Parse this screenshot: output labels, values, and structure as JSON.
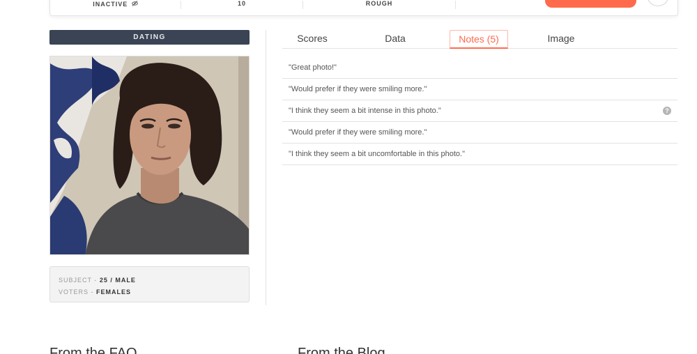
{
  "topbar": {
    "status_label": "INACTIVE",
    "status_icon": "eye-slash-icon",
    "count_value": "10",
    "mode_label": "ROUGH"
  },
  "left": {
    "category": "DATING",
    "subject_key": "SUBJECT",
    "subject_value": "25 / MALE",
    "voters_key": "VOTERS",
    "voters_value": "FEMALES",
    "separator": " - "
  },
  "tabs": [
    {
      "label": "Scores"
    },
    {
      "label": "Data"
    },
    {
      "label": "Notes (5)"
    },
    {
      "label": "Image"
    }
  ],
  "active_tab": "Notes (5)",
  "notes": [
    {
      "text": "\"Great photo!\""
    },
    {
      "text": "\"Would prefer if they were smiling more.\""
    },
    {
      "text": "\"I think they seem a bit intense in this photo.\""
    },
    {
      "text": "\"Would prefer if they were smiling more.\""
    },
    {
      "text": "\"I think they seem a bit uncomfortable in this photo.\""
    }
  ],
  "help_icon_glyph": "?",
  "footer": {
    "left_heading": "From the FAQ",
    "right_heading": "From the Blog"
  },
  "colors": {
    "accent": "#ff6a4d",
    "category_bar": "#3b4454"
  }
}
